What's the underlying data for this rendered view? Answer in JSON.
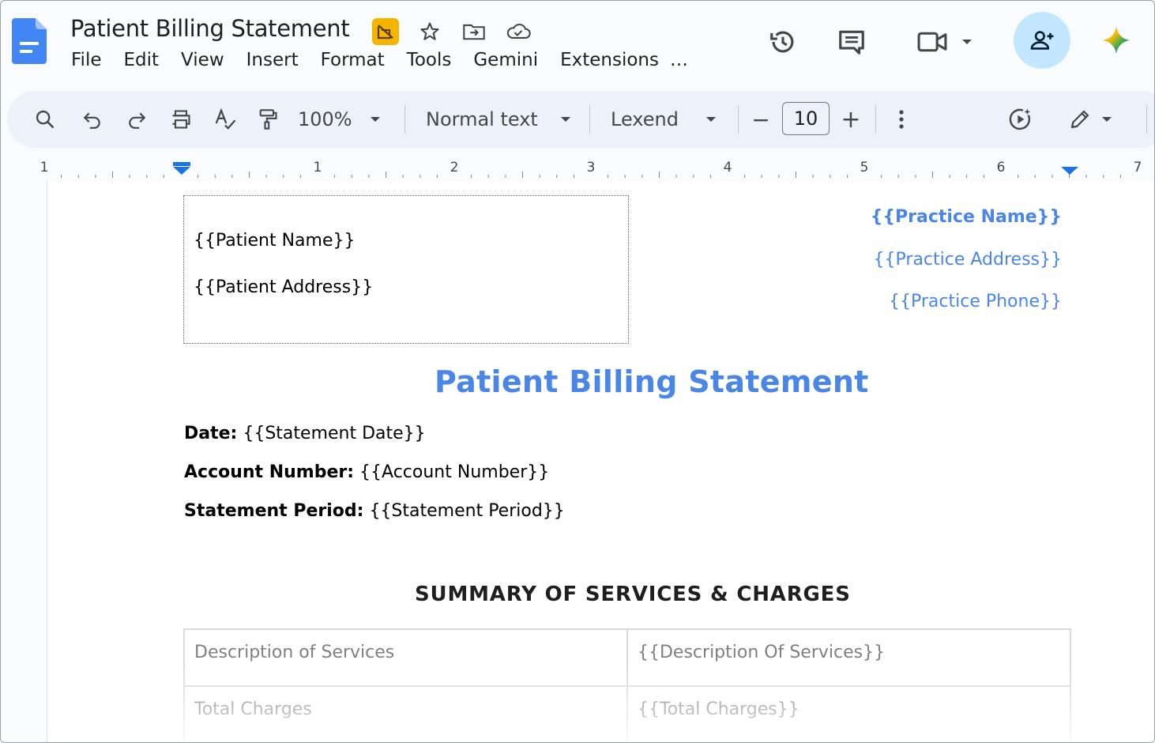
{
  "app": {
    "doc_title": "Patient Billing Statement",
    "menu": [
      "File",
      "Edit",
      "View",
      "Insert",
      "Format",
      "Tools",
      "Gemini",
      "Extensions",
      "…"
    ],
    "title_icons": [
      "move-to-folder-badge-icon",
      "star-icon",
      "move-icon",
      "cloud-saved-icon"
    ],
    "top_right_icons": [
      "version-history-icon",
      "comments-icon",
      "meet-icon",
      "share-icon",
      "gemini-icon"
    ]
  },
  "toolbar": {
    "zoom": "100%",
    "style": "Normal text",
    "font": "Lexend",
    "font_size": "10",
    "minus": "−",
    "plus": "+"
  },
  "ruler": {
    "labels": [
      "1",
      "1",
      "2",
      "3",
      "4",
      "5",
      "6",
      "7"
    ]
  },
  "document": {
    "patient_name": "{{Patient Name}}",
    "patient_address": "{{Patient Address}}",
    "practice_name": "{{Practice Name}}",
    "practice_address": "{{Practice Address}}",
    "practice_phone": "{{Practice Phone}}",
    "heading": "Patient Billing Statement",
    "fields": [
      {
        "label": "Date:",
        "value": "{{Statement Date}}"
      },
      {
        "label": "Account Number:",
        "value": "{{Account Number}}"
      },
      {
        "label": "Statement Period:",
        "value": "{{Statement Period}}"
      }
    ],
    "section_title": "SUMMARY OF SERVICES & CHARGES",
    "table": [
      [
        "Description of Services",
        "{{Description Of Services}}"
      ],
      [
        "Total Charges",
        "{{Total Charges}}"
      ]
    ]
  },
  "colors": {
    "accent_blue": "#4a86e8",
    "docs_blue": "#4285f4",
    "share_bg": "#c2e7ff",
    "toolbar_bg": "#edf2fa"
  }
}
